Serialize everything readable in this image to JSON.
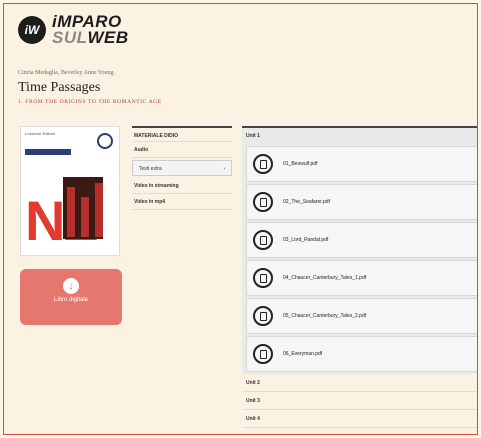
{
  "logo": {
    "badge": "iW",
    "line1": "iMPARO",
    "line2a": "SUL",
    "line2b": "WEB"
  },
  "book": {
    "authors": "Cinzia Medaglia, Beverley Anne Young",
    "title": "Time Passages",
    "subtitle": "1. FROM THE ORIGINS TO THE ROMANTIC AGE"
  },
  "cover": {
    "publisher": "Loescher Editore",
    "letters": "NE"
  },
  "download": {
    "icon": "download-icon",
    "label": "Libro digitale"
  },
  "menu": {
    "header": "MATERIALE DIDIO",
    "audio": "Audio",
    "testi_label": "Testi extra",
    "testi_arrow": "›",
    "streaming": "Video in streaming",
    "mp4": "Video in mp4"
  },
  "units": {
    "unit1": "Unit 1",
    "files": [
      "01_Beowulf.pdf",
      "02_The_Seafarer.pdf",
      "03_Lord_Randal.pdf",
      "04_Chaucer_Canterbury_Tales_1.pdf",
      "05_Chaucer_Canterbury_Tales_2.pdf",
      "06_Everyman.pdf"
    ],
    "unit2": "Unit 2",
    "unit3": "Unit 3",
    "unit4": "Unit 4"
  },
  "colors": {
    "accent": "#d94a38",
    "download_bg": "#e5776e",
    "background": "#fbf2e3"
  }
}
